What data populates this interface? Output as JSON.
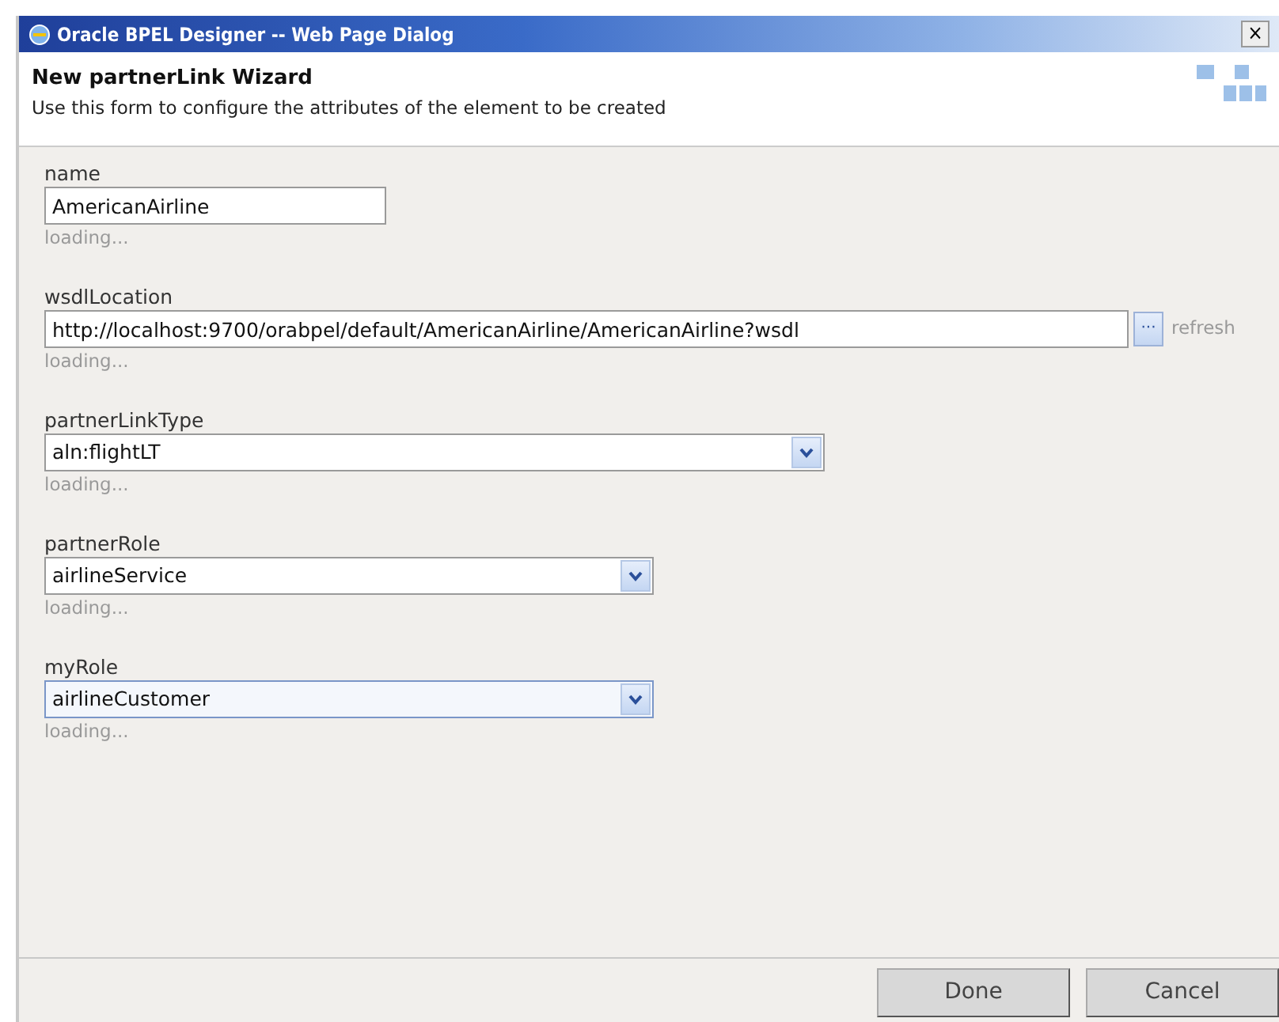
{
  "window": {
    "title": "Oracle BPEL Designer -- Web Page Dialog",
    "close": "×"
  },
  "header": {
    "title": "New partnerLink Wizard",
    "subtitle": "Use this form to configure the attributes of the element to be created"
  },
  "fields": [
    {
      "kind": "text",
      "label": "name",
      "value": "AmericanAirline",
      "status": "loading...",
      "focused": false
    },
    {
      "kind": "browse",
      "label": "wsdlLocation",
      "value": "http://localhost:9700/orabpel/default/AmericanAirline/AmericanAirline?wsdl",
      "browse": "···",
      "link": "refresh",
      "status": "loading...",
      "focused": false
    },
    {
      "kind": "select",
      "label": "partnerLinkType",
      "value": "aln:flightLT",
      "status": "loading...",
      "focused": false
    },
    {
      "kind": "select",
      "label": "partnerRole",
      "value": "airlineService",
      "status": "loading...",
      "focused": false
    },
    {
      "kind": "select",
      "label": "myRole",
      "value": "airlineCustomer",
      "status": "loading...",
      "focused": true
    }
  ],
  "buttons": [
    "Done",
    "Cancel"
  ]
}
